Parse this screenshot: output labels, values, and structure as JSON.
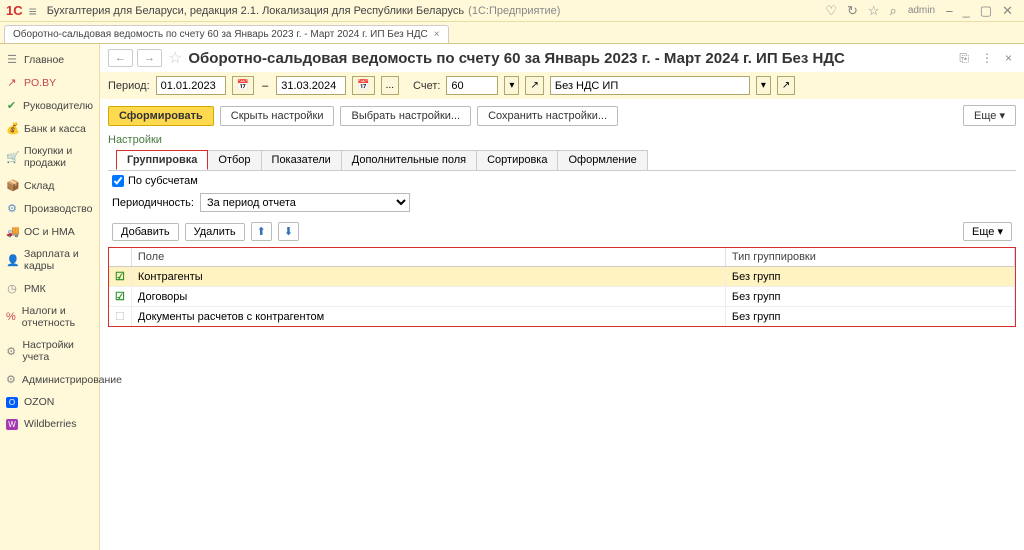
{
  "titlebar": {
    "logo": "1C",
    "app_title": "Бухгалтерия для Беларуси, редакция 2.1. Локализация для Республики Беларусь",
    "app_sub": "(1С:Предприятие)",
    "admin": "admin"
  },
  "doctab": {
    "title": "Оборотно-сальдовая ведомость по счету 60 за Январь 2023 г. - Март 2024 г. ИП Без НДС"
  },
  "sidebar": {
    "items": [
      {
        "icon": "☰",
        "label": "Главное"
      },
      {
        "icon": "↗",
        "label": "PO.BY"
      },
      {
        "icon": "✔",
        "label": "Руководителю"
      },
      {
        "icon": "💰",
        "label": "Банк и касса"
      },
      {
        "icon": "🛒",
        "label": "Покупки и продажи"
      },
      {
        "icon": "📦",
        "label": "Склад"
      },
      {
        "icon": "⚙",
        "label": "Производство"
      },
      {
        "icon": "🚚",
        "label": "ОС и НМА"
      },
      {
        "icon": "👤",
        "label": "Зарплата и кадры"
      },
      {
        "icon": "◷",
        "label": "РМК"
      },
      {
        "icon": "%",
        "label": "Налоги и отчетность"
      },
      {
        "icon": "⚙",
        "label": "Настройки учета"
      },
      {
        "icon": "⚙",
        "label": "Администрирование"
      },
      {
        "icon": "O",
        "label": "OZON"
      },
      {
        "icon": "W",
        "label": "Wildberries"
      }
    ]
  },
  "page": {
    "title": "Оборотно-сальдовая ведомость по счету 60 за Январь 2023 г. - Март 2024 г. ИП Без НДС"
  },
  "params": {
    "period_label": "Период:",
    "from": "01.01.2023",
    "to": "31.03.2024",
    "account_label": "Счет:",
    "account": "60",
    "org": "Без НДС ИП"
  },
  "actions": {
    "form": "Сформировать",
    "hide": "Скрыть настройки",
    "choose": "Выбрать настройки...",
    "save": "Сохранить настройки...",
    "more": "Еще ▾"
  },
  "settings_label": "Настройки",
  "tabs": {
    "items": [
      "Группировка",
      "Отбор",
      "Показатели",
      "Дополнительные поля",
      "Сортировка",
      "Оформление"
    ]
  },
  "group": {
    "subacc_label": "По субсчетам",
    "period_label": "Периодичность:",
    "period_value": "За период отчета",
    "add": "Добавить",
    "del": "Удалить",
    "up": "⬆",
    "down": "⬇",
    "more": "Еще ▾",
    "col_field": "Поле",
    "col_type": "Тип группировки",
    "rows": [
      {
        "on": true,
        "field": "Контрагенты",
        "type": "Без групп"
      },
      {
        "on": true,
        "field": "Договоры",
        "type": "Без групп"
      },
      {
        "on": false,
        "field": "Документы расчетов с контрагентом",
        "type": "Без групп"
      }
    ]
  }
}
